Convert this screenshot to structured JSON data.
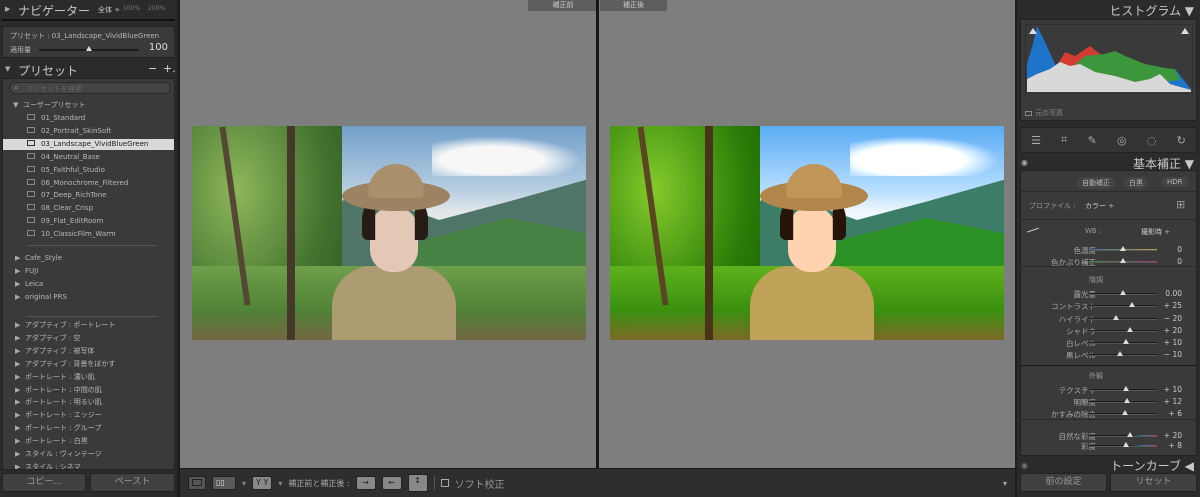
{
  "navigator": {
    "title": "ナビゲーター",
    "zoom_fit": "全体 ÷",
    "zoom_100": "100%",
    "zoom_200": "200%"
  },
  "preset_info": {
    "label": "プリセット : 03_Landscape_VividBlueGreen",
    "amount_label": "適用量",
    "amount_value": "100",
    "amount": 100
  },
  "presets": {
    "title": "プリセット",
    "minus": "−",
    "plus": "+.",
    "search_placeholder": "プリセットを検索",
    "user_group": "ユーザープリセット",
    "user_items": [
      "01_Standard",
      "02_Portrait_SkinSoft",
      "03_Landscape_VividBlueGreen",
      "04_Neutral_Base",
      "05_Faithful_Studio",
      "06_Monochrome_Filtered",
      "07_Deep_RichTone",
      "08_Clear_Crisp",
      "09_Flat_EditRoom",
      "10_ClassicFilm_Warm"
    ],
    "selected_index": 2,
    "groups": [
      "Cafe_Style",
      "FUJI",
      "Leica",
      "original PRS"
    ],
    "builtin": [
      "アダプティブ : ポートレート",
      "アダプティブ : 空",
      "アダプティブ : 被写体",
      "アダプティブ : 背景をぼかす",
      "ポートレート : 濃い肌",
      "ポートレート : 中間の肌",
      "ポートレート : 明るい肌",
      "ポートレート : エッジー",
      "ポートレート : グループ",
      "ポートレート : 白黒",
      "スタイル : ヴィンテージ",
      "スタイル : シネマ"
    ]
  },
  "left_buttons": {
    "copy": "コピー...",
    "paste": "ペースト"
  },
  "view": {
    "before_label": "補正前",
    "after_label": "補正後"
  },
  "toolbar": {
    "yy": "Y Y",
    "before_after_label": "補正前と補正後 :",
    "soft_proof": "ソフト校正",
    "soft_proof_checked": false
  },
  "histogram": {
    "title": "ヒストグラム ▼",
    "original_photo": "元の写真",
    "colors": {
      "blue": "#1e74c8",
      "red": "#d23c32",
      "green": "#3c963c",
      "white": "#d8d8d8"
    }
  },
  "tools": [
    "sliders-icon",
    "crop-icon",
    "heal-icon",
    "redeye-icon",
    "mask-icon",
    "reset-icon"
  ],
  "basic": {
    "title": "基本補正 ▼",
    "auto": "自動補正",
    "bw": "白黒",
    "hdr": "HDR",
    "profile_label": "プロファイル :",
    "profile_value": "カラー ÷",
    "wb_label": "WB :",
    "wb_value": "撮影時 ÷",
    "wb_sliders": [
      {
        "label": "色温度",
        "value": "0",
        "num": 0,
        "min": -100,
        "max": 100
      },
      {
        "label": "色かぶり補正",
        "value": "0",
        "num": 0,
        "min": -100,
        "max": 100
      }
    ],
    "tone_title": "階調",
    "tone_sliders": [
      {
        "label": "露光量",
        "value": "0.00",
        "num": 0,
        "min": -5,
        "max": 5
      },
      {
        "label": "コントラスト",
        "value": "+ 25",
        "num": 25,
        "min": -100,
        "max": 100
      },
      {
        "label": "ハイライト",
        "value": "− 20",
        "num": -20,
        "min": -100,
        "max": 100
      },
      {
        "label": "シャドウ",
        "value": "+ 20",
        "num": 20,
        "min": -100,
        "max": 100
      },
      {
        "label": "白レベル",
        "value": "+ 10",
        "num": 10,
        "min": -100,
        "max": 100
      },
      {
        "label": "黒レベル",
        "value": "− 10",
        "num": -10,
        "min": -100,
        "max": 100
      }
    ],
    "presence_title": "外観",
    "presence_sliders": [
      {
        "label": "テクスチャ",
        "value": "+ 10",
        "num": 10,
        "min": -100,
        "max": 100
      },
      {
        "label": "明瞭度",
        "value": "+ 12",
        "num": 12,
        "min": -100,
        "max": 100
      },
      {
        "label": "かすみの除去",
        "value": "+ 6",
        "num": 6,
        "min": -100,
        "max": 100
      }
    ],
    "color_sliders": [
      {
        "label": "自然な彩度",
        "value": "+ 20",
        "num": 20,
        "min": -100,
        "max": 100
      },
      {
        "label": "彩度",
        "value": "+ 8",
        "num": 8,
        "min": -100,
        "max": 100
      }
    ]
  },
  "tone_curve": {
    "title": "トーンカーブ ◀"
  },
  "right_buttons": {
    "previous": "前の設定",
    "reset": "リセット"
  }
}
